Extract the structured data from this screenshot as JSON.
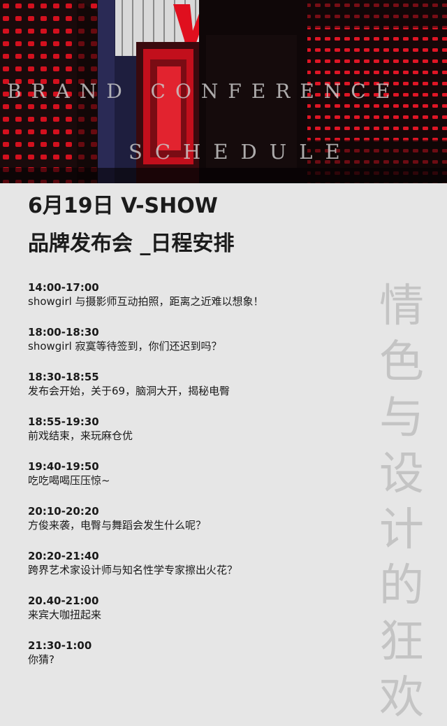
{
  "banner": {
    "overlay_line1": "BRAND CONFERENCE",
    "overlay_line2": "SCHEDULE",
    "logo_letter": "V"
  },
  "headline": {
    "line1": "6月19日  V-SHOW",
    "line2": "品牌发布会 _日程安排"
  },
  "schedule": [
    {
      "time": "14:00-17:00",
      "desc": "showgirl 与摄影师互动拍照，距离之近难以想象！"
    },
    {
      "time": "18:00-18:30",
      "desc": "showgirl 寂寞等待签到，你们还迟到吗？"
    },
    {
      "time": "18:30-18:55",
      "desc": "发布会开始，关于69，脑洞大开，揭秘电臀"
    },
    {
      "time": "18:55-19:30",
      "desc": "前戏结束，来玩麻仓优"
    },
    {
      "time": "19:40-19:50",
      "desc": "吃吃喝喝压压惊~"
    },
    {
      "time": "20:10-20:20",
      "desc": "方俊来袭，电臀与舞蹈会发生什么呢？"
    },
    {
      "time": "20:20-21:40",
      "desc": "跨界艺术家设计师与知名性学专家擦出火花？"
    },
    {
      "time": "20.40-21:00",
      "desc": "来宾大咖扭起来"
    },
    {
      "time": "21:30-1:00",
      "desc": "你猜?"
    }
  ],
  "vertical_text": [
    "情",
    "色",
    "与",
    "设",
    "计",
    "的",
    "狂",
    "欢"
  ],
  "colors": {
    "background": "#e6e6e6",
    "accent_red": "#e00f1e",
    "text": "#1a1a1a",
    "vertical_text": "#c4c4c4"
  }
}
